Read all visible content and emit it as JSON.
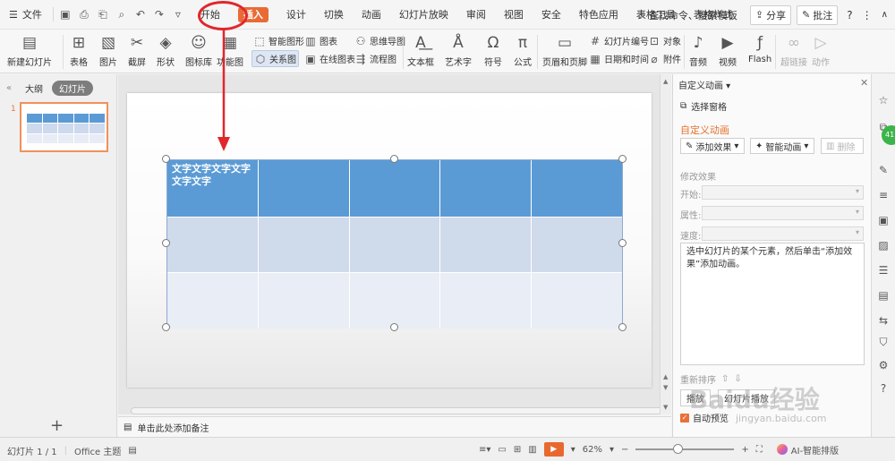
{
  "menubar": {
    "file_label": "文件",
    "tabs": [
      "开始",
      "插入",
      "设计",
      "切换",
      "动画",
      "幻灯片放映",
      "审阅",
      "视图",
      "安全",
      "特色应用",
      "表格工具",
      "表格样式"
    ],
    "active_tab": "插入",
    "search_label": "查找命令、搜索模板",
    "share_label": "分享",
    "comment_label": "批注"
  },
  "ribbon": {
    "new_slide": "新建幻灯片",
    "table": "表格",
    "picture": "图片",
    "screenshot": "截屏",
    "shape": "形状",
    "icon_lib": "图标库",
    "function_chart": "功能图",
    "smart_graphic": "智能图形",
    "relation_graph": "关系图",
    "chart": "图表",
    "online_chart": "在线图表",
    "mind_map": "思维导图",
    "flow_chart": "流程图",
    "textbox": "文本框",
    "wordart": "艺术字",
    "symbol": "符号",
    "formula": "公式",
    "header_footer": "页眉和页脚",
    "slide_number": "幻灯片编号",
    "date_time": "日期和时间",
    "object": "对象",
    "attachment": "附件",
    "audio": "音频",
    "video": "视频",
    "flash": "Flash",
    "hyperlink": "超链接",
    "action": "动作"
  },
  "leftpane": {
    "outline_tab": "大纲",
    "slides_tab": "幻灯片",
    "slide_number": "1"
  },
  "slide": {
    "cell_text": "文字文字文字文字文字文字"
  },
  "notes": {
    "placeholder": "单击此处添加备注"
  },
  "taskpane": {
    "title": "自定义动画",
    "select_pane": "选择窗格",
    "heading": "自定义动画",
    "add_effect": "添加效果",
    "smart_anim": "智能动画",
    "delete": "删除",
    "modify_effect": "修改效果",
    "start_label": "开始:",
    "property_label": "属性:",
    "speed_label": "速度:",
    "hint": "选中幻灯片的某个元素，然后单击“添加效果”添加动画。",
    "reorder": "重新排序",
    "play": "播放",
    "slideshow": "幻灯片播放",
    "auto_preview": "自动预览"
  },
  "statusbar": {
    "slide_count": "幻灯片 1 / 1",
    "theme": "Office 主题",
    "zoom": "62%",
    "ai_label": "AI-智能排版"
  },
  "watermark": {
    "main": "Baidu经验",
    "sub": "jingyan.baidu.com"
  },
  "colors": {
    "accent": "#e86b35",
    "table_header": "#5b9bd5",
    "table_row1": "#cfdaeb",
    "table_row2": "#e8edf6",
    "annotation": "#e0272c"
  }
}
